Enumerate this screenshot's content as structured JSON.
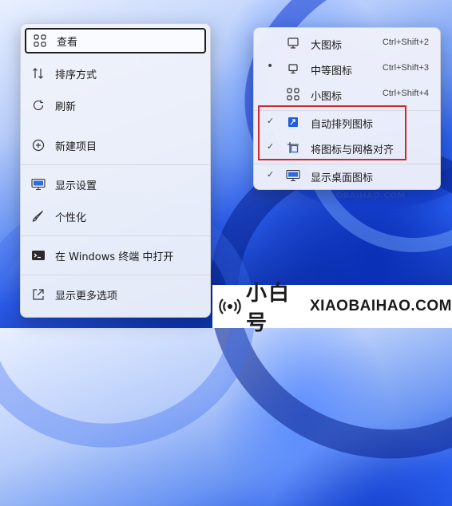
{
  "watermark": {
    "cn": "@小白号",
    "en": "XIAOBAIHAO.COM",
    "url_small": "xiaobaihao.com"
  },
  "context_menu": {
    "items": [
      {
        "label": "查看",
        "icon": "grid-view-icon"
      },
      {
        "label": "排序方式",
        "icon": "sort-icon"
      },
      {
        "label": "刷新",
        "icon": "refresh-icon"
      },
      {
        "label": "新建项目",
        "icon": "plus-circle-icon"
      },
      {
        "label": "显示设置",
        "icon": "display-icon"
      },
      {
        "label": "个性化",
        "icon": "brush-icon"
      },
      {
        "label": "在 Windows 终端 中打开",
        "icon": "terminal-icon"
      },
      {
        "label": "显示更多选项",
        "icon": "share-icon"
      }
    ],
    "selected_index": 0
  },
  "submenu": {
    "items": [
      {
        "label": "大图标",
        "shortcut": "Ctrl+Shift+2",
        "check": "",
        "icon": "monitor-icon"
      },
      {
        "label": "中等图标",
        "shortcut": "Ctrl+Shift+3",
        "check": "•",
        "icon": "monitor-icon"
      },
      {
        "label": "小图标",
        "shortcut": "Ctrl+Shift+4",
        "check": "",
        "icon": "grid-view-icon"
      },
      {
        "label": "自动排列图标",
        "shortcut": "",
        "check": "✓",
        "icon": "auto-arrange-icon"
      },
      {
        "label": "将图标与网格对齐",
        "shortcut": "",
        "check": "✓",
        "icon": "grid-align-icon"
      },
      {
        "label": "显示桌面图标",
        "shortcut": "",
        "check": "✓",
        "icon": "desktop-icon"
      }
    ]
  },
  "brand": {
    "logo_icon": "broadcast-icon",
    "name_cn": "小白号",
    "name_en": "XIAOBAIHAO.COM"
  },
  "colors": {
    "highlight_border": "#d3262b",
    "accent_blue": "#1f5fe0"
  }
}
